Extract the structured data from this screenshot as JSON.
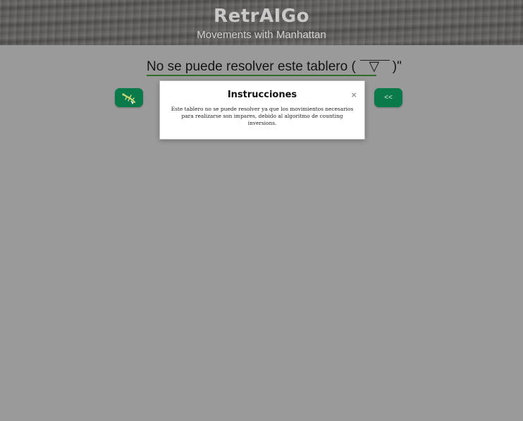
{
  "header": {
    "title": "RetrAIGo",
    "subtitle": "Movements with Manhattan"
  },
  "board": {
    "status_prefix": "No se puede resolver este tablero (",
    "kaomoji": "▽",
    "status_suffix": ")\""
  },
  "buttons": {
    "left_icon": "lizard-icon",
    "back_label": "<<"
  },
  "modal": {
    "title": "Instrucciones",
    "close_label": "×",
    "message": "Este tablero no se puede resolver ya que los movimientos necesarios para realizarse son impares, debido al algoritmo de counting inversions."
  },
  "colors": {
    "background": "#9a9a9a",
    "button": "#0b7a4a",
    "underline": "#2f6b2a"
  }
}
